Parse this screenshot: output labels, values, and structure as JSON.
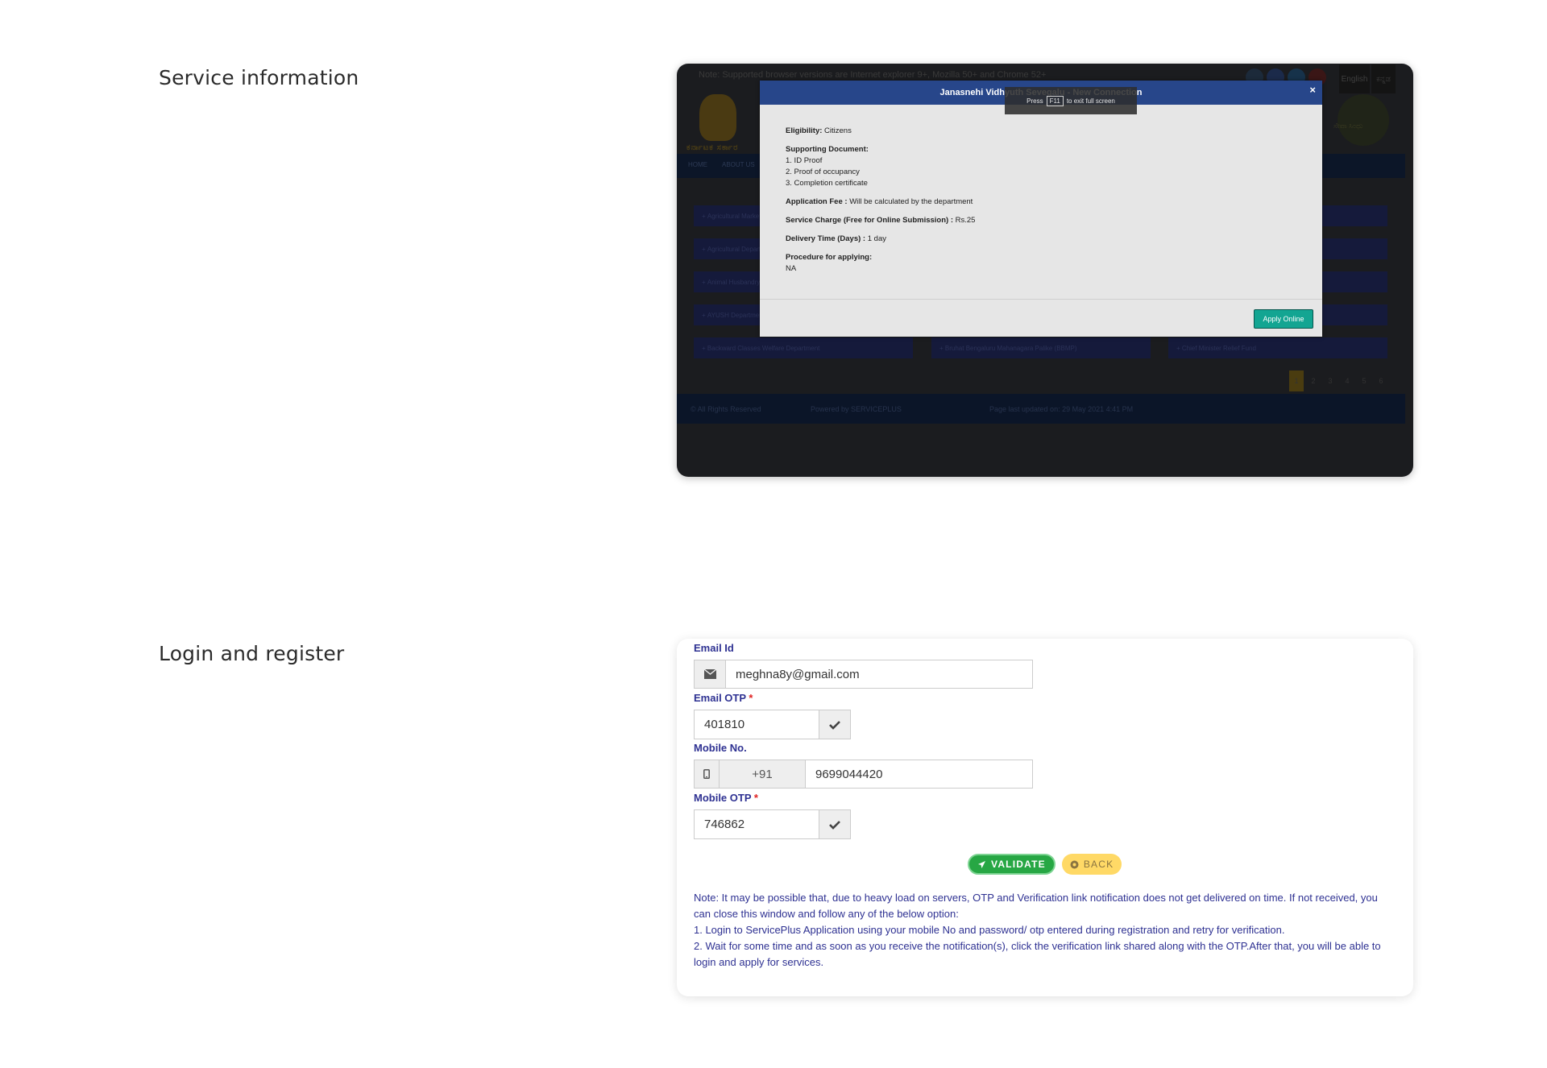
{
  "sections": {
    "service_info_title": "Service information",
    "login_title": "Login and register"
  },
  "background_site": {
    "note": "Note: Supported browser versions are Internet explorer 9+, Mozilla 50+ and Chrome 52+",
    "lang_en": "English",
    "lang_kn": "ಕನ್ನಡ",
    "emblem_text": "ಕರ್ನಾಟಕ ಸರ್ಕಾರ",
    "tree_text": "ಸೇವಾ ಸಿಂಧು",
    "nav": [
      "HOME",
      "ABOUT US"
    ],
    "services": [
      "Agricultural Marketing",
      "Agricultural Department",
      "Animal Husbandry",
      "AYUSH Department",
      "Backward Classes Welfare Department",
      "Bruhat Bengaluru Mahanagara Palike (BBMP)",
      "Chief Minister Relief Fund"
    ],
    "pages": [
      "1",
      "2",
      "3",
      "4",
      "5",
      "6"
    ],
    "footer": {
      "rights": "© All Rights Reserved",
      "powered": "Powered by SERVICEPLUS",
      "updated": "Page last updated on: 29 May 2021 4:41 PM"
    }
  },
  "modal": {
    "title": "Janasnehi Vidhyuth Sevegalu - New Connection",
    "close": "×",
    "fullscreen_press": "Press",
    "fullscreen_key": "F11",
    "fullscreen_rest": "to exit full screen",
    "eligibility_label": "Eligibility:",
    "eligibility_value": "Citizens",
    "docs_label": "Supporting Document:",
    "docs": [
      "1. ID Proof",
      "2. Proof of occupancy",
      "3. Completion certificate"
    ],
    "fee_label": "Application Fee :",
    "fee_value": "Will be calculated by the department",
    "charge_label": "Service Charge (Free for Online Submission) :",
    "charge_value": "Rs.25",
    "delivery_label": "Delivery Time (Days) :",
    "delivery_value": "1 day",
    "procedure_label": "Procedure for applying:",
    "procedure_value": "NA",
    "apply_button": "Apply Online"
  },
  "form": {
    "email_label": "Email Id",
    "email_value": "meghna8y@gmail.com",
    "email_otp_label": "Email OTP",
    "email_otp_value": "401810",
    "mobile_label": "Mobile No.",
    "country_code": "+91",
    "mobile_value": "9699044420",
    "mobile_otp_label": "Mobile OTP",
    "mobile_otp_value": "746862",
    "required_mark": "*",
    "validate_button": "VALIDATE",
    "back_button": "BACK",
    "note_lines": [
      "Note: It may be possible that, due to heavy load on servers, OTP and Verification link notification does not get delivered on time. If not received, you can close this window and follow any of the below option:",
      "1. Login to ServicePlus Application using your mobile No and password/ otp entered during registration and retry for verification.",
      "2. Wait for some time and as soon as you receive the notification(s), click the verification link shared along with the OTP.After that, you will be able to login and apply for services."
    ]
  },
  "icons": {
    "email": "envelope-icon",
    "check": "check-icon",
    "mobile": "mobile-phone-icon",
    "validate": "paper-plane-icon",
    "back": "circle-back-icon"
  },
  "colors": {
    "modal_header": "#27468a",
    "apply_button": "#13a592",
    "form_label": "#2e3192",
    "validate": "#27a744",
    "back": "#ffd966",
    "required": "#e02222"
  }
}
